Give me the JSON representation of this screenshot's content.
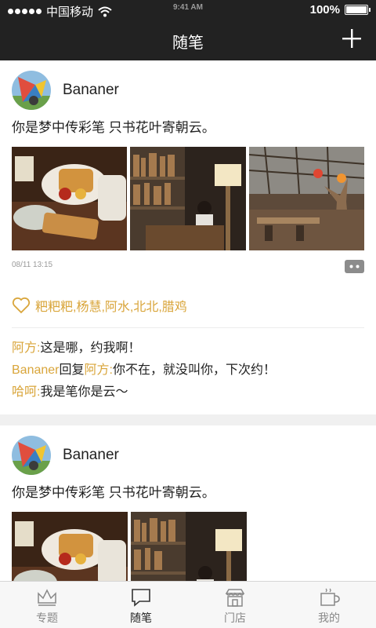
{
  "status_bar": {
    "carrier": "中国移动",
    "time": "9:41 AM",
    "battery": "100%"
  },
  "header": {
    "title": "随笔",
    "add_icon": "plus-icon"
  },
  "posts": [
    {
      "author": "Bananer",
      "text": "你是梦中传彩笔 只书花叶寄朝云。",
      "timestamp": "08/11  13:15",
      "likes": "粑粑粑,杨慧,阿水,北北,腊鸡",
      "comments": [
        {
          "who": "阿方:",
          "body": "这是哪，约我啊！"
        },
        {
          "who": "Bananer",
          "mid": "回复",
          "who2": "阿方:",
          "body": "你不在，就没叫你，下次约！"
        },
        {
          "who": "哈呵:",
          "body": "我是笔你是云～"
        }
      ]
    },
    {
      "author": "Bananer",
      "text": "你是梦中传彩笔 只书花叶寄朝云。"
    }
  ],
  "tabs": [
    {
      "label": "专题",
      "icon": "crown-icon",
      "active": false
    },
    {
      "label": "随笔",
      "icon": "note-icon",
      "active": true
    },
    {
      "label": "门店",
      "icon": "store-icon",
      "active": false
    },
    {
      "label": "我的",
      "icon": "cup-icon",
      "active": false
    }
  ],
  "colors": {
    "topbar": "#222222",
    "accent": "#d9a53a",
    "background": "#ffffff",
    "band": "#f0f0f0"
  }
}
